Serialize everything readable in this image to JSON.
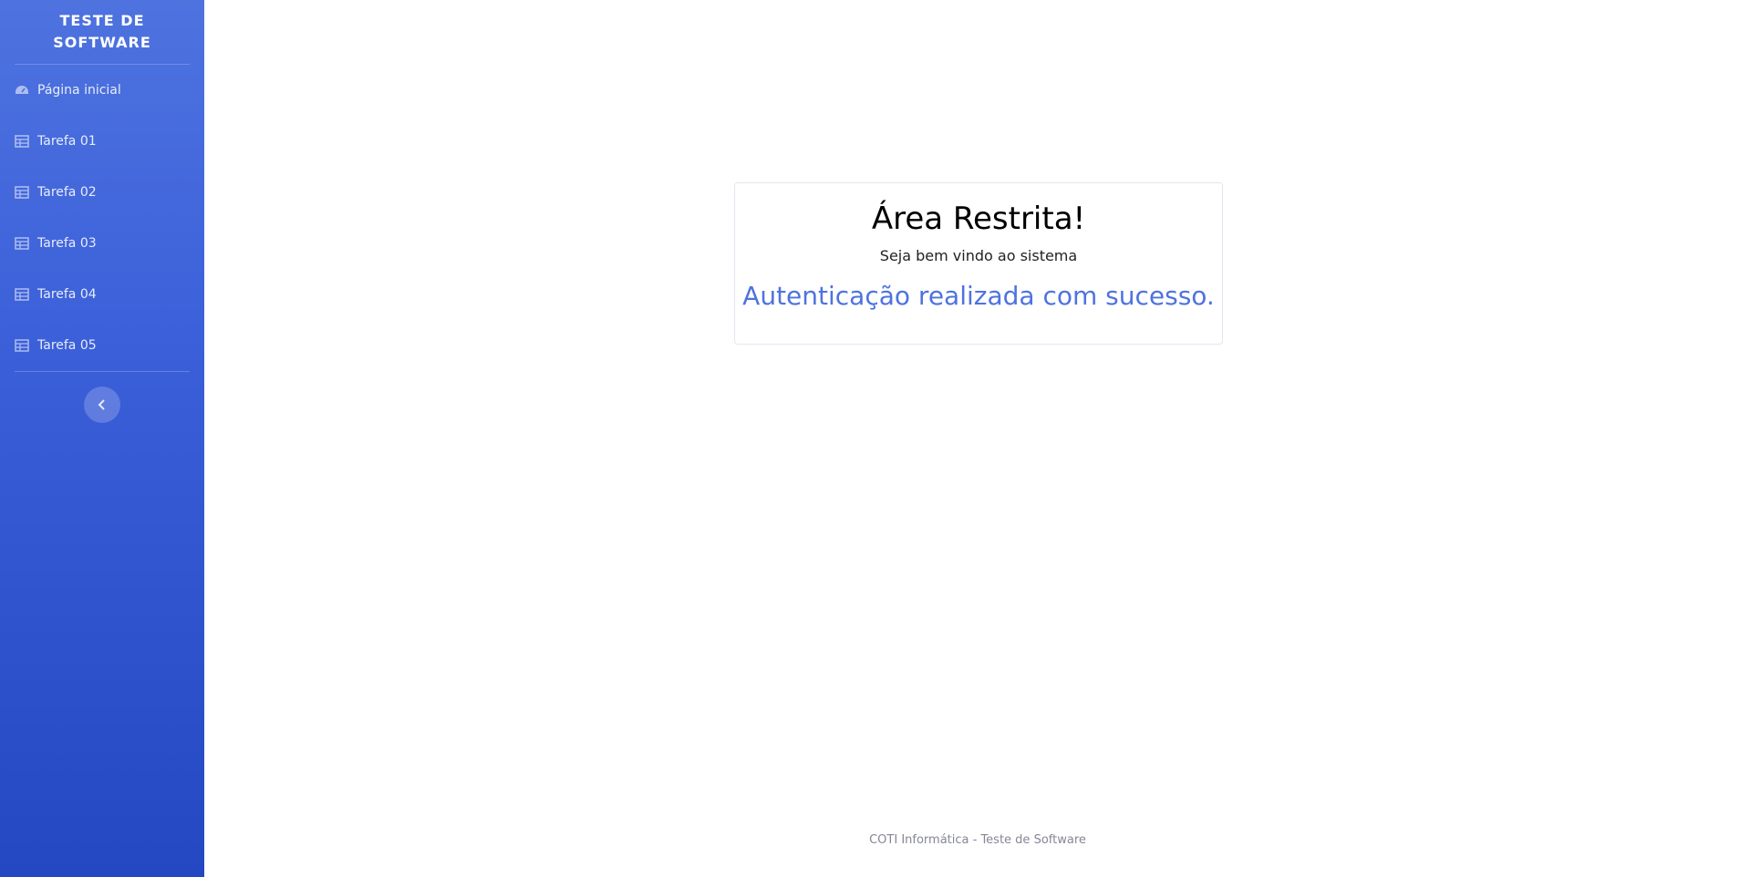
{
  "sidebar": {
    "brand": "TESTE DE SOFTWARE",
    "items": [
      {
        "label": "Página inicial",
        "icon": "tachometer-icon"
      },
      {
        "label": "Tarefa 01",
        "icon": "table-icon"
      },
      {
        "label": "Tarefa 02",
        "icon": "table-icon"
      },
      {
        "label": "Tarefa 03",
        "icon": "table-icon"
      },
      {
        "label": "Tarefa 04",
        "icon": "table-icon"
      },
      {
        "label": "Tarefa 05",
        "icon": "table-icon"
      }
    ],
    "toggle_icon": "chevron-left-icon"
  },
  "main": {
    "title": "Área Restrita!",
    "subtitle": "Seja bem vindo ao sistema",
    "message": "Autenticação realizada com sucesso."
  },
  "footer": {
    "text": "COTI Informática - Teste de Software"
  },
  "colors": {
    "sidebar_top": "#4e73df",
    "sidebar_bottom": "#2448c2",
    "accent": "#4e73df",
    "footer_text": "#858796"
  }
}
